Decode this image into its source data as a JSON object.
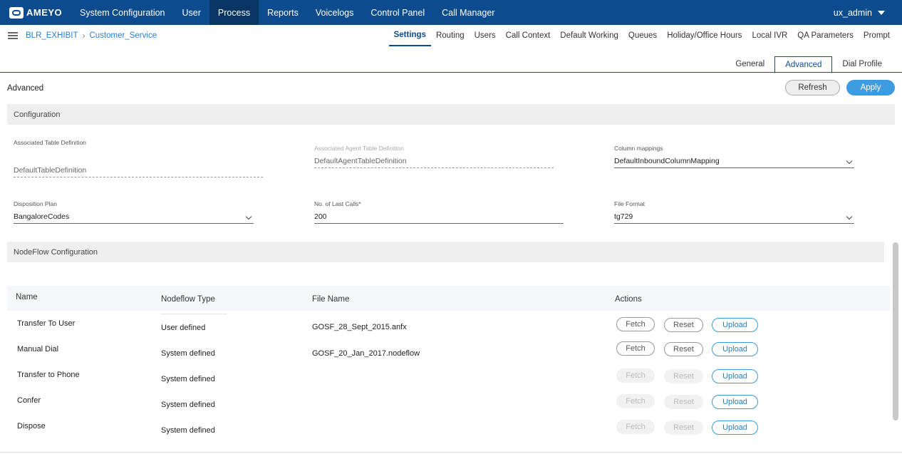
{
  "brand": {
    "name": "AMEYO"
  },
  "topnav": {
    "items": [
      "System Configuration",
      "User",
      "Process",
      "Reports",
      "Voicelogs",
      "Control Panel",
      "Call Manager"
    ],
    "active": "Process",
    "user": "ux_admin"
  },
  "breadcrumb": {
    "campaign": "BLR_EXHIBIT",
    "process": "Customer_Service"
  },
  "subtabs": [
    "Settings",
    "Routing",
    "Users",
    "Call Context",
    "Default Working",
    "Queues",
    "Holiday/Office Hours",
    "Local IVR",
    "QA Parameters",
    "Prompt"
  ],
  "innertabs": [
    "General",
    "Advanced",
    "Dial Profile"
  ],
  "page": {
    "title": "Advanced",
    "refresh_label": "Refresh",
    "apply_label": "Apply"
  },
  "configuration": {
    "title": "Configuration",
    "associated_table": {
      "label": "Associated Table Definition",
      "value": "DefaultTableDefinition"
    },
    "associated_agent_table": {
      "label": "Associated Agent Table Definition",
      "value": "DefaultAgentTableDefinition"
    },
    "column_mappings": {
      "label": "Column mappings",
      "value": "DefaultInboundColumnMapping"
    },
    "disposition_plan": {
      "label": "Disposition Plan",
      "value": "BangaloreCodes"
    },
    "last_calls": {
      "label": "No. of Last Calls*",
      "value": "200"
    },
    "file_format": {
      "label": "File Format",
      "value": "tg729"
    }
  },
  "nodeflow": {
    "title": "NodeFlow Configuration",
    "columns": {
      "name": "Name",
      "type": "Nodeflow Type",
      "file": "File Name",
      "actions": "Actions"
    },
    "actions": {
      "fetch": "Fetch",
      "reset": "Reset",
      "upload": "Upload"
    },
    "rows": [
      {
        "name": "Transfer To User",
        "type": "User defined",
        "file": "GOSF_28_Sept_2015.anfx"
      },
      {
        "name": "Manual Dial",
        "type": "System defined",
        "file": "GOSF_20_Jan_2017.nodeflow"
      },
      {
        "name": "Transfer to Phone",
        "type": "System defined",
        "file": ""
      },
      {
        "name": "Confer",
        "type": "System defined",
        "file": ""
      },
      {
        "name": "Dispose",
        "type": "System defined",
        "file": ""
      }
    ]
  },
  "colors": {
    "nav_bg": "#0c4b8e",
    "accent": "#3d9be0",
    "link": "#2a7fd0"
  }
}
